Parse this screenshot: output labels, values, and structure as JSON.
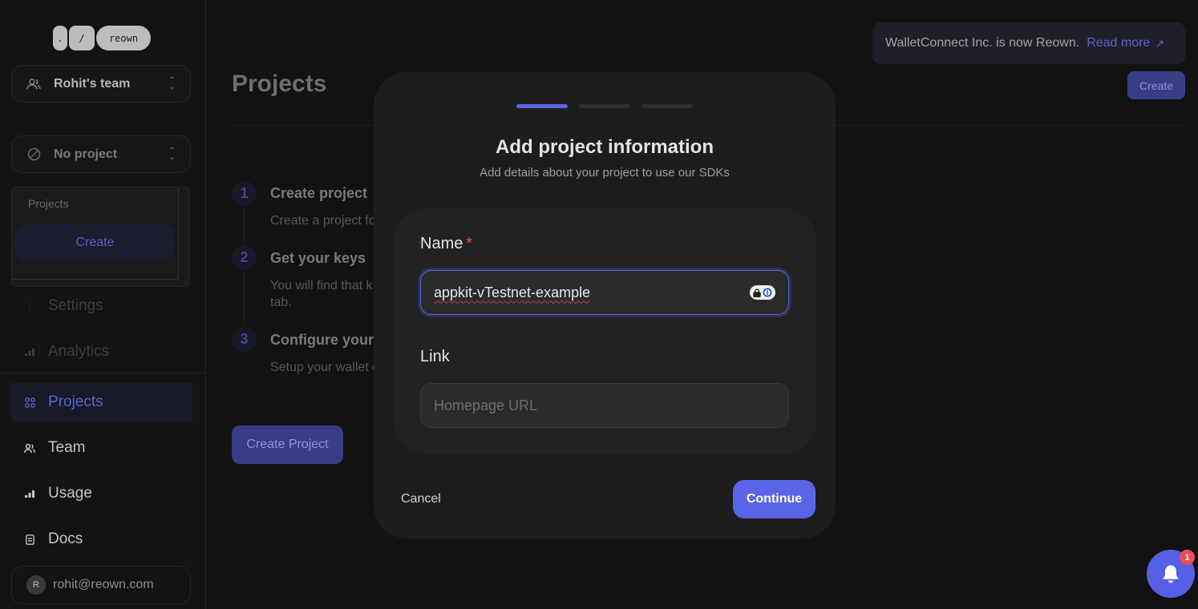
{
  "sidebar": {
    "logo": [
      ".",
      "/",
      "reown"
    ],
    "team_selector": "Rohit's team",
    "project_selector": "No project",
    "dropdown": {
      "section_label": "Projects",
      "create_label": "Create"
    },
    "dim_items": [
      "Settings",
      "Analytics"
    ],
    "nav_items": [
      "Projects",
      "Team",
      "Usage",
      "Docs"
    ],
    "user_email": "rohit@reown.com",
    "user_initial": "R"
  },
  "banner": {
    "text": "WalletConnect Inc. is now Reown.",
    "link": "Read more"
  },
  "main": {
    "title": "Projects",
    "create_button": "Create",
    "steps": [
      {
        "number": "1",
        "title": "Create project",
        "desc": "Create a project fo"
      },
      {
        "number": "2",
        "title": "Get your keys",
        "desc_line1": "You will find that k",
        "desc_line2": "tab."
      },
      {
        "number": "3",
        "title": "Configure your",
        "desc": "Setup your wallet c"
      }
    ],
    "create_project_button": "Create Project"
  },
  "modal": {
    "progress_steps": 3,
    "current_step": 1,
    "title": "Add project information",
    "subtitle": "Add details about your project to use our SDKs",
    "name_label": "Name",
    "required_mark": "*",
    "name_value": "appkit-vTestnet-example",
    "link_label": "Link",
    "link_placeholder": "Homepage URL",
    "cancel_label": "Cancel",
    "continue_label": "Continue"
  },
  "notifications": {
    "badge_count": "1"
  },
  "colors": {
    "accent": "#5a64e6",
    "accent_dim": "#373e85",
    "error": "#e55a5a",
    "badge": "#ef4d5a"
  }
}
